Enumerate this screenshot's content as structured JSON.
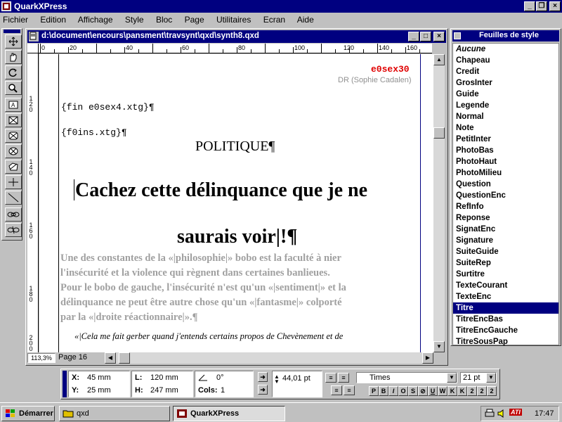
{
  "app": {
    "title": "QuarkXPress",
    "menu": [
      "Fichier",
      "Edition",
      "Affichage",
      "Style",
      "Bloc",
      "Page",
      "Utilitaires",
      "Ecran",
      "Aide"
    ]
  },
  "document": {
    "path": "d:\\document\\encours\\pansment\\travsynt\\qxd\\synth8.qxd",
    "ruler_h": [
      "0",
      "20",
      "40",
      "60",
      "80",
      "100",
      "120",
      "140",
      "160"
    ],
    "ruler_v": [
      "120",
      "140",
      "160",
      "180",
      "200"
    ],
    "code_label": "e0sex30",
    "credit": "DR (Sophie Cadalen)",
    "line_fin": "{fin e0sex4.xtg}¶",
    "line_ins": "{f0ins.xtg}¶",
    "kicker": "POLITIQUE¶",
    "headline_1": "Cachez cette délinquance que je ne",
    "headline_2": "saurais voir|!¶",
    "body_lines": [
      "Une des constantes de la «|philosophie|» bobo est la faculté à nier",
      "l'insécurité et la violence qui règnent dans certaines banlieues.",
      "Pour le bobo de gauche, l'insécurité n'est qu'un «|sentiment|» et la",
      "délinquance ne peut être autre chose qu'un «|fantasme|» colporté",
      "par la «|droite réactionnaire|».¶"
    ],
    "quote_line": "«|Cela me fait gerber quand j'entends certains propos de Chevènement et de",
    "zoom": "113,3%",
    "page": "Page 16"
  },
  "style_sheets": {
    "title": "Feuilles de style",
    "items": [
      "Aucune",
      "Chapeau",
      "Credit",
      "GrosInter",
      "Guide",
      "Legende",
      "Normal",
      "Note",
      "PetitInter",
      "PhotoBas",
      "PhotoHaut",
      "PhotoMilieu",
      "Question",
      "QuestionEnc",
      "RefInfo",
      "Reponse",
      "SignatEnc",
      "Signature",
      "SuiteGuide",
      "SuiteRep",
      "Surtitre",
      "TexteCourant",
      "TexteEnc",
      "Titre",
      "TitreEncBas",
      "TitreEncGauche",
      "TitreSousPap"
    ],
    "selected": "Titre"
  },
  "measurements": {
    "x_label": "X:",
    "x_value": "45 mm",
    "y_label": "Y:",
    "y_value": "25 mm",
    "l_label": "L:",
    "l_value": "120 mm",
    "h_label": "H:",
    "h_value": "247 mm",
    "angle": "0°",
    "cols_label": "Cols:",
    "cols_value": "1",
    "leading": "44,01 pt",
    "font": "Times",
    "size": "21 pt",
    "style_buttons": [
      "P",
      "B",
      "I",
      "O",
      "S",
      "⊘",
      "U",
      "W",
      "K",
      "K",
      "2",
      "2",
      "2"
    ]
  },
  "taskbar": {
    "start": "Démarrer",
    "tasks": [
      "qxd",
      "QuarkXPress"
    ],
    "ati": "ATI",
    "clock": "17:47"
  }
}
